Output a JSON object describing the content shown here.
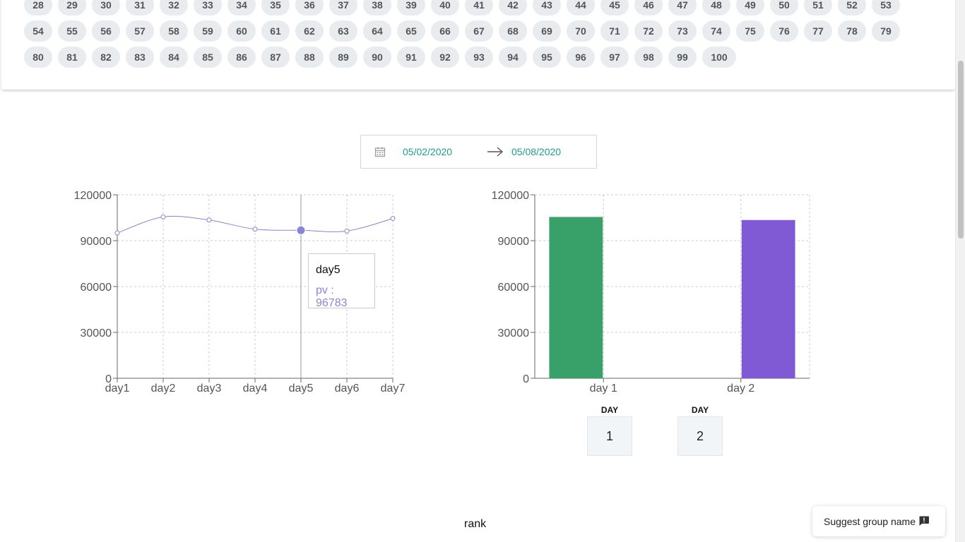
{
  "numbers": {
    "row1": [
      "28",
      "29",
      "30",
      "31",
      "32",
      "33",
      "34",
      "35",
      "36",
      "37",
      "38",
      "39",
      "40",
      "41",
      "42",
      "43",
      "44",
      "45",
      "46",
      "47",
      "48",
      "49",
      "50",
      "51",
      "52",
      "53"
    ],
    "row2": [
      "54",
      "55",
      "56",
      "57",
      "58",
      "59",
      "60",
      "61",
      "62",
      "63",
      "64",
      "65",
      "66",
      "67",
      "68",
      "69",
      "70",
      "71",
      "72",
      "73",
      "74",
      "75",
      "76",
      "77",
      "78",
      "79"
    ],
    "row3": [
      "80",
      "81",
      "82",
      "83",
      "84",
      "85",
      "86",
      "87",
      "88",
      "89",
      "90",
      "91",
      "92",
      "93",
      "94",
      "95",
      "96",
      "97",
      "98",
      "99",
      "100"
    ]
  },
  "date_range": {
    "start": "05/02/2020",
    "end": "05/08/2020",
    "icon": "calendar-icon",
    "separator_icon": "arrow-right-icon",
    "accent_color": "#1a9e8f"
  },
  "tooltip": {
    "title": "day5",
    "row": "pv : 96783"
  },
  "day_boxes": [
    {
      "header": "DAY",
      "value": "1"
    },
    {
      "header": "DAY",
      "value": "2"
    }
  ],
  "rank_label": "rank",
  "suggest_button": {
    "label": "Suggest group name",
    "icon": "feedback-icon"
  },
  "chart_data": [
    {
      "type": "line",
      "x": [
        "day1",
        "day2",
        "day3",
        "day4",
        "day5",
        "day6",
        "day7"
      ],
      "series": [
        {
          "values": [
            95000,
            105500,
            103500,
            97500,
            96783,
            96300,
            104500
          ],
          "color": "#8884d8"
        }
      ],
      "yticks": [
        0,
        30000,
        60000,
        90000,
        120000
      ],
      "ylim": [
        0,
        120000
      ],
      "grid": true,
      "active_point": "day5"
    },
    {
      "type": "bar",
      "categories": [
        "day 1",
        "day 2"
      ],
      "series": [
        {
          "values": [
            105500,
            null
          ],
          "color": "#38a169"
        },
        {
          "values": [
            null,
            103500
          ],
          "color": "#805ad5"
        }
      ],
      "yticks": [
        0,
        30000,
        60000,
        90000,
        120000
      ],
      "ylim": [
        0,
        120000
      ],
      "grid": true
    }
  ]
}
